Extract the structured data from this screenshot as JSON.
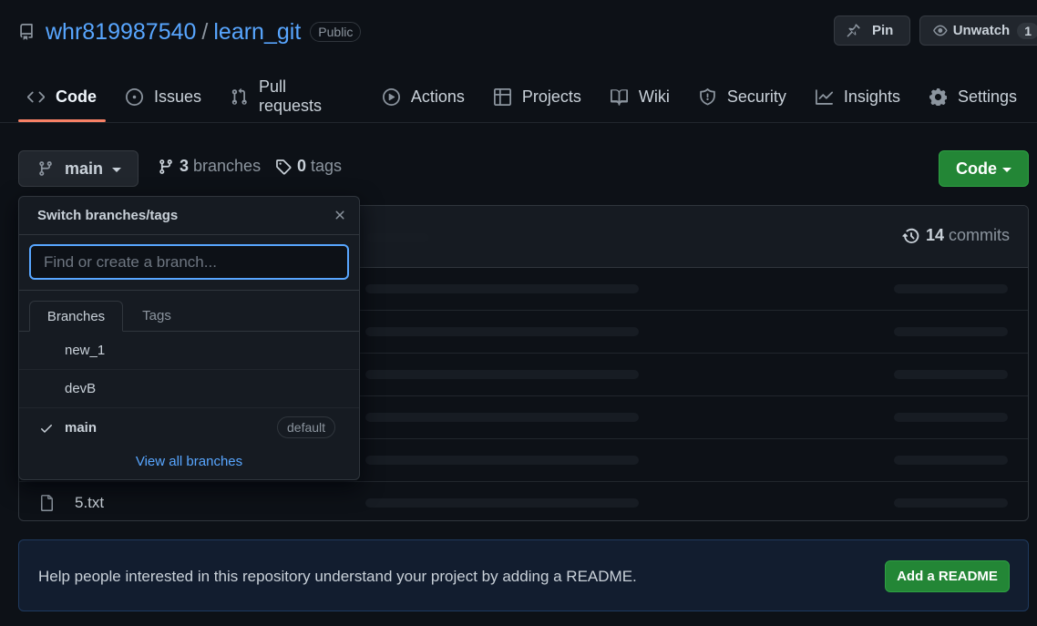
{
  "repo": {
    "owner": "whr819987540",
    "separator": "/",
    "name": "learn_git",
    "visibility": "Public"
  },
  "header_actions": {
    "pin_label": "Pin",
    "watch_label": "Unwatch",
    "watch_count": "1"
  },
  "nav": {
    "tabs": [
      {
        "label": "Code",
        "icon": "code-icon",
        "active": true
      },
      {
        "label": "Issues",
        "icon": "issue-icon"
      },
      {
        "label": "Pull requests",
        "icon": "pull-request-icon"
      },
      {
        "label": "Actions",
        "icon": "play-icon"
      },
      {
        "label": "Projects",
        "icon": "table-icon"
      },
      {
        "label": "Wiki",
        "icon": "book-icon"
      },
      {
        "label": "Security",
        "icon": "shield-icon"
      },
      {
        "label": "Insights",
        "icon": "graph-icon"
      },
      {
        "label": "Settings",
        "icon": "gear-icon"
      }
    ]
  },
  "branch_bar": {
    "current_branch": "main",
    "branches_count": "3",
    "branches_label": "branches",
    "tags_count": "0",
    "tags_label": "tags",
    "code_button": "Code"
  },
  "files": {
    "commits_count": "14",
    "commits_label": "commits",
    "rows": [
      {
        "name": ""
      },
      {
        "name": ""
      },
      {
        "name": ""
      },
      {
        "name": ""
      },
      {
        "name": ""
      },
      {
        "name": "5.txt"
      }
    ]
  },
  "branch_dropdown": {
    "title": "Switch branches/tags",
    "filter_placeholder": "Find or create a branch...",
    "tabs": {
      "branches": "Branches",
      "tags": "Tags"
    },
    "branches": [
      {
        "name": "new_1"
      },
      {
        "name": "devB"
      },
      {
        "name": "main",
        "selected": true,
        "badge": "default"
      }
    ],
    "view_all": "View all branches"
  },
  "readme_banner": {
    "text": "Help people interested in this repository understand your project by adding a README.",
    "button": "Add a README"
  },
  "colors": {
    "background": "#0d1117",
    "link": "#58a6ff",
    "green_button": "#238636",
    "active_tab_underline": "#f78166"
  }
}
